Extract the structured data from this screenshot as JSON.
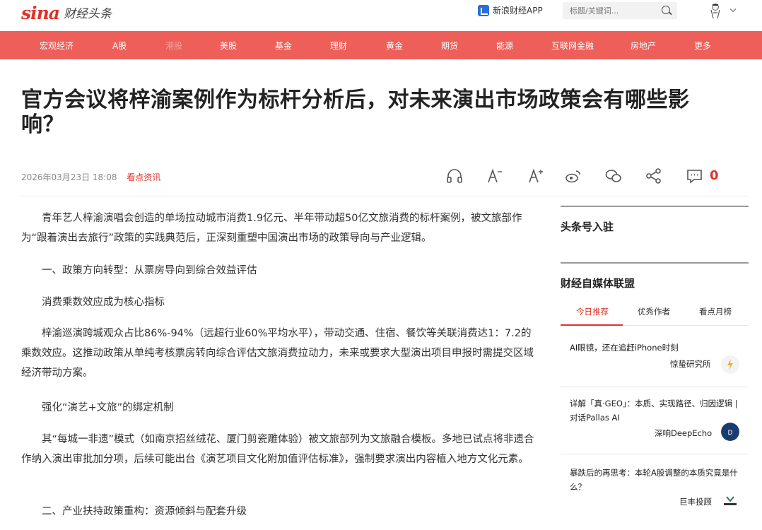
{
  "header": {
    "logo_mark": "sina",
    "logo_text": "财经头条",
    "app_link": "新浪财经APP",
    "search_placeholder": "标题/关键词...",
    "icons": [
      "app-icon",
      "search-icon",
      "avatar",
      "chevron-down-icon"
    ]
  },
  "nav": {
    "items": [
      "宏观经济",
      "A股",
      "港股",
      "美股",
      "基金",
      "理财",
      "黄金",
      "期货",
      "能源",
      "互联网金融",
      "房地产",
      "更多"
    ]
  },
  "article": {
    "title": "官方会议将梓渝案例作为标杆分析后，对未来演出市场政策会有哪些影响？",
    "date": "2026年03月23日 18:08",
    "source": "看点资讯",
    "comment_count": "0",
    "paragraphs": [
      "青年艺人梓渝演唱会创造的单场拉动城市消费1.9亿元、半年带动超50亿文旅消费的标杆案例，被文旅部作为“跟着演出去旅行”政策的实践典范后，正深刻重塑中国演出市场的政策导向与产业逻辑。",
      "一、政策方向转型：从票房导向到综合效益评估",
      "消费乘数效应成为核心指标",
      "梓渝巡演跨城观众占比86%-94%（远超行业60%平均水平），带动交通、住宿、餐饮等关联消费达1：7.2的乘数效应。这推动政策从单纯考核票房转向综合评估文旅消费拉动力，未来或要求大型演出项目申报时需提交区域经济带动方案。",
      "强化“演艺+文旅”的绑定机制",
      "其“每城一非遗”模式（如南京招丝绒花、厦门剪瓷雕体验）被文旅部列为文旅融合模板。多地已试点将非遗合作纳入演出审批加分项，后续可能出台《演艺项目文化附加值评估标准》，强制要求演出内容植入地方文化元素。",
      "二、产业扶持政策重构：资源倾斜与配套升级"
    ]
  },
  "toolbar": {
    "icons": [
      "headphones-icon",
      "font-decrease-icon",
      "font-increase-icon",
      "weibo-icon",
      "wechat-icon",
      "share-icon",
      "comment-icon"
    ]
  },
  "sidebar": {
    "apply_title": "头条号入驻",
    "alliance_title": "财经自媒体联盟",
    "tabs": [
      "今日推荐",
      "优秀作者",
      "看点月榜"
    ],
    "news": [
      {
        "title": "AI眼镜，还在追赶iPhone时刻",
        "source": "惊蛰研究所"
      },
      {
        "title": "详解「真·GEO」：本质、实现路径、归因逻辑 | 对话Pallas AI",
        "source": "深响DeepEcho"
      },
      {
        "title": "暴跌后的再思考：本轮A股调整的本质究竟是什么？",
        "source": "巨丰投顾"
      }
    ]
  }
}
